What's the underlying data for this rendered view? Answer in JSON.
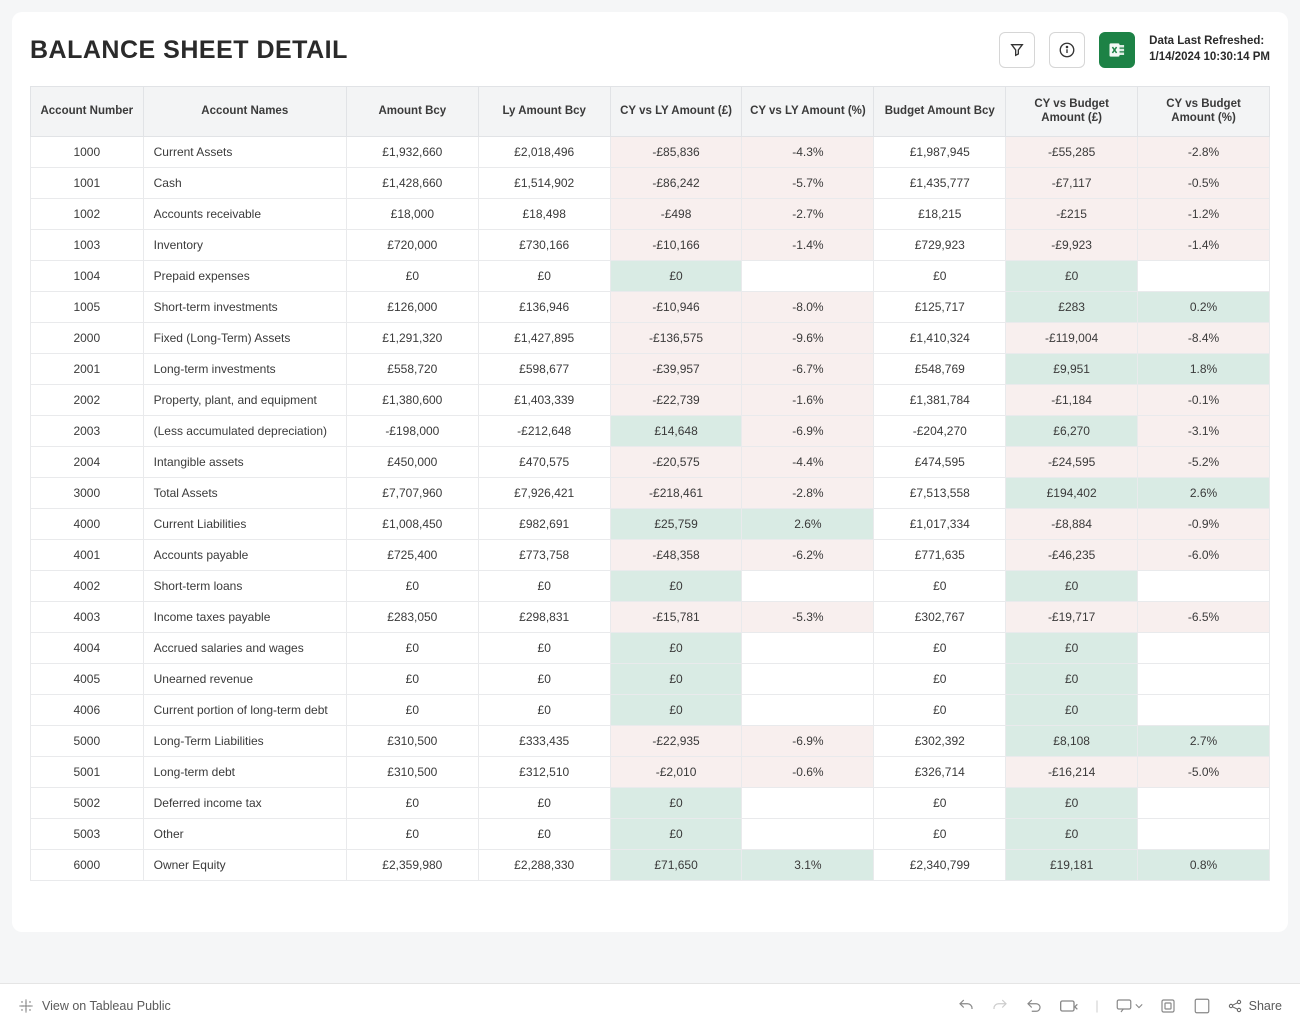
{
  "title": "BALANCE SHEET DETAIL",
  "refresh": {
    "label": "Data Last Refreshed:",
    "value": "1/14/2024 10:30:14 PM"
  },
  "columns": [
    "Account Number",
    "Account Names",
    "Amount Bcy",
    "Ly Amount Bcy",
    "CY vs LY Amount (£)",
    "CY vs LY Amount (%)",
    "Budget Amount Bcy",
    "CY vs Budget Amount (£)",
    "CY vs Budget Amount (%)"
  ],
  "rows": [
    {
      "num": "1000",
      "name": "Current Assets",
      "amt": "£1,932,660",
      "ly": "£2,018,496",
      "cylyA": "-£85,836",
      "cylyA_s": "neg",
      "cylyP": "-4.3%",
      "cylyP_s": "neg",
      "bud": "£1,987,945",
      "cybA": "-£55,285",
      "cybA_s": "neg",
      "cybP": "-2.8%",
      "cybP_s": "neg"
    },
    {
      "num": "1001",
      "name": "Cash",
      "amt": "£1,428,660",
      "ly": "£1,514,902",
      "cylyA": "-£86,242",
      "cylyA_s": "neg",
      "cylyP": "-5.7%",
      "cylyP_s": "neg",
      "bud": "£1,435,777",
      "cybA": "-£7,117",
      "cybA_s": "neg",
      "cybP": "-0.5%",
      "cybP_s": "neg"
    },
    {
      "num": "1002",
      "name": "Accounts receivable",
      "amt": "£18,000",
      "ly": "£18,498",
      "cylyA": "-£498",
      "cylyA_s": "neg",
      "cylyP": "-2.7%",
      "cylyP_s": "neg",
      "bud": "£18,215",
      "cybA": "-£215",
      "cybA_s": "neg",
      "cybP": "-1.2%",
      "cybP_s": "neg"
    },
    {
      "num": "1003",
      "name": "Inventory",
      "amt": "£720,000",
      "ly": "£730,166",
      "cylyA": "-£10,166",
      "cylyA_s": "neg",
      "cylyP": "-1.4%",
      "cylyP_s": "neg",
      "bud": "£729,923",
      "cybA": "-£9,923",
      "cybA_s": "neg",
      "cybP": "-1.4%",
      "cybP_s": "neg"
    },
    {
      "num": "1004",
      "name": "Prepaid expenses",
      "amt": "£0",
      "ly": "£0",
      "cylyA": "£0",
      "cylyA_s": "zero",
      "cylyP": "",
      "cylyP_s": "blank",
      "bud": "£0",
      "cybA": "£0",
      "cybA_s": "zero",
      "cybP": "",
      "cybP_s": "blank"
    },
    {
      "num": "1005",
      "name": "Short-term investments",
      "amt": "£126,000",
      "ly": "£136,946",
      "cylyA": "-£10,946",
      "cylyA_s": "neg",
      "cylyP": "-8.0%",
      "cylyP_s": "neg",
      "bud": "£125,717",
      "cybA": "£283",
      "cybA_s": "pos",
      "cybP": "0.2%",
      "cybP_s": "pos"
    },
    {
      "num": "2000",
      "name": "Fixed (Long-Term) Assets",
      "amt": "£1,291,320",
      "ly": "£1,427,895",
      "cylyA": "-£136,575",
      "cylyA_s": "neg",
      "cylyP": "-9.6%",
      "cylyP_s": "neg",
      "bud": "£1,410,324",
      "cybA": "-£119,004",
      "cybA_s": "neg",
      "cybP": "-8.4%",
      "cybP_s": "neg"
    },
    {
      "num": "2001",
      "name": "Long-term investments",
      "amt": "£558,720",
      "ly": "£598,677",
      "cylyA": "-£39,957",
      "cylyA_s": "neg",
      "cylyP": "-6.7%",
      "cylyP_s": "neg",
      "bud": "£548,769",
      "cybA": "£9,951",
      "cybA_s": "pos",
      "cybP": "1.8%",
      "cybP_s": "pos"
    },
    {
      "num": "2002",
      "name": "Property, plant, and equipment",
      "amt": "£1,380,600",
      "ly": "£1,403,339",
      "cylyA": "-£22,739",
      "cylyA_s": "neg",
      "cylyP": "-1.6%",
      "cylyP_s": "neg",
      "bud": "£1,381,784",
      "cybA": "-£1,184",
      "cybA_s": "neg",
      "cybP": "-0.1%",
      "cybP_s": "neg"
    },
    {
      "num": "2003",
      "name": "(Less accumulated depreciation)",
      "amt": "-£198,000",
      "ly": "-£212,648",
      "cylyA": "£14,648",
      "cylyA_s": "pos",
      "cylyP": "-6.9%",
      "cylyP_s": "neg",
      "bud": "-£204,270",
      "cybA": "£6,270",
      "cybA_s": "pos",
      "cybP": "-3.1%",
      "cybP_s": "neg"
    },
    {
      "num": "2004",
      "name": "Intangible assets",
      "amt": "£450,000",
      "ly": "£470,575",
      "cylyA": "-£20,575",
      "cylyA_s": "neg",
      "cylyP": "-4.4%",
      "cylyP_s": "neg",
      "bud": "£474,595",
      "cybA": "-£24,595",
      "cybA_s": "neg",
      "cybP": "-5.2%",
      "cybP_s": "neg"
    },
    {
      "num": "3000",
      "name": "Total Assets",
      "amt": "£7,707,960",
      "ly": "£7,926,421",
      "cylyA": "-£218,461",
      "cylyA_s": "neg",
      "cylyP": "-2.8%",
      "cylyP_s": "neg",
      "bud": "£7,513,558",
      "cybA": "£194,402",
      "cybA_s": "pos",
      "cybP": "2.6%",
      "cybP_s": "pos"
    },
    {
      "num": "4000",
      "name": "Current Liabilities",
      "amt": "£1,008,450",
      "ly": "£982,691",
      "cylyA": "£25,759",
      "cylyA_s": "pos",
      "cylyP": "2.6%",
      "cylyP_s": "pos",
      "bud": "£1,017,334",
      "cybA": "-£8,884",
      "cybA_s": "neg",
      "cybP": "-0.9%",
      "cybP_s": "neg"
    },
    {
      "num": "4001",
      "name": "Accounts payable",
      "amt": "£725,400",
      "ly": "£773,758",
      "cylyA": "-£48,358",
      "cylyA_s": "neg",
      "cylyP": "-6.2%",
      "cylyP_s": "neg",
      "bud": "£771,635",
      "cybA": "-£46,235",
      "cybA_s": "neg",
      "cybP": "-6.0%",
      "cybP_s": "neg"
    },
    {
      "num": "4002",
      "name": "Short-term loans",
      "amt": "£0",
      "ly": "£0",
      "cylyA": "£0",
      "cylyA_s": "zero",
      "cylyP": "",
      "cylyP_s": "blank",
      "bud": "£0",
      "cybA": "£0",
      "cybA_s": "zero",
      "cybP": "",
      "cybP_s": "blank"
    },
    {
      "num": "4003",
      "name": "Income taxes payable",
      "amt": "£283,050",
      "ly": "£298,831",
      "cylyA": "-£15,781",
      "cylyA_s": "neg",
      "cylyP": "-5.3%",
      "cylyP_s": "neg",
      "bud": "£302,767",
      "cybA": "-£19,717",
      "cybA_s": "neg",
      "cybP": "-6.5%",
      "cybP_s": "neg"
    },
    {
      "num": "4004",
      "name": "Accrued salaries and wages",
      "amt": "£0",
      "ly": "£0",
      "cylyA": "£0",
      "cylyA_s": "zero",
      "cylyP": "",
      "cylyP_s": "blank",
      "bud": "£0",
      "cybA": "£0",
      "cybA_s": "zero",
      "cybP": "",
      "cybP_s": "blank"
    },
    {
      "num": "4005",
      "name": "Unearned revenue",
      "amt": "£0",
      "ly": "£0",
      "cylyA": "£0",
      "cylyA_s": "zero",
      "cylyP": "",
      "cylyP_s": "blank",
      "bud": "£0",
      "cybA": "£0",
      "cybA_s": "zero",
      "cybP": "",
      "cybP_s": "blank"
    },
    {
      "num": "4006",
      "name": "Current portion of long-term debt",
      "amt": "£0",
      "ly": "£0",
      "cylyA": "£0",
      "cylyA_s": "zero",
      "cylyP": "",
      "cylyP_s": "blank",
      "bud": "£0",
      "cybA": "£0",
      "cybA_s": "zero",
      "cybP": "",
      "cybP_s": "blank"
    },
    {
      "num": "5000",
      "name": "Long-Term Liabilities",
      "amt": "£310,500",
      "ly": "£333,435",
      "cylyA": "-£22,935",
      "cylyA_s": "neg",
      "cylyP": "-6.9%",
      "cylyP_s": "neg",
      "bud": "£302,392",
      "cybA": "£8,108",
      "cybA_s": "pos",
      "cybP": "2.7%",
      "cybP_s": "pos"
    },
    {
      "num": "5001",
      "name": "Long-term debt",
      "amt": "£310,500",
      "ly": "£312,510",
      "cylyA": "-£2,010",
      "cylyA_s": "neg",
      "cylyP": "-0.6%",
      "cylyP_s": "neg",
      "bud": "£326,714",
      "cybA": "-£16,214",
      "cybA_s": "neg",
      "cybP": "-5.0%",
      "cybP_s": "neg"
    },
    {
      "num": "5002",
      "name": "Deferred income tax",
      "amt": "£0",
      "ly": "£0",
      "cylyA": "£0",
      "cylyA_s": "zero",
      "cylyP": "",
      "cylyP_s": "blank",
      "bud": "£0",
      "cybA": "£0",
      "cybA_s": "zero",
      "cybP": "",
      "cybP_s": "blank"
    },
    {
      "num": "5003",
      "name": "Other",
      "amt": "£0",
      "ly": "£0",
      "cylyA": "£0",
      "cylyA_s": "zero",
      "cylyP": "",
      "cylyP_s": "blank",
      "bud": "£0",
      "cybA": "£0",
      "cybA_s": "zero",
      "cybP": "",
      "cybP_s": "blank"
    },
    {
      "num": "6000",
      "name": "Owner Equity",
      "amt": "£2,359,980",
      "ly": "£2,288,330",
      "cylyA": "£71,650",
      "cylyA_s": "pos",
      "cylyP": "3.1%",
      "cylyP_s": "pos",
      "bud": "£2,340,799",
      "cybA": "£19,181",
      "cybA_s": "pos",
      "cybP": "0.8%",
      "cybP_s": "pos"
    }
  ],
  "footer": {
    "view": "View on Tableau Public",
    "share": "Share"
  }
}
